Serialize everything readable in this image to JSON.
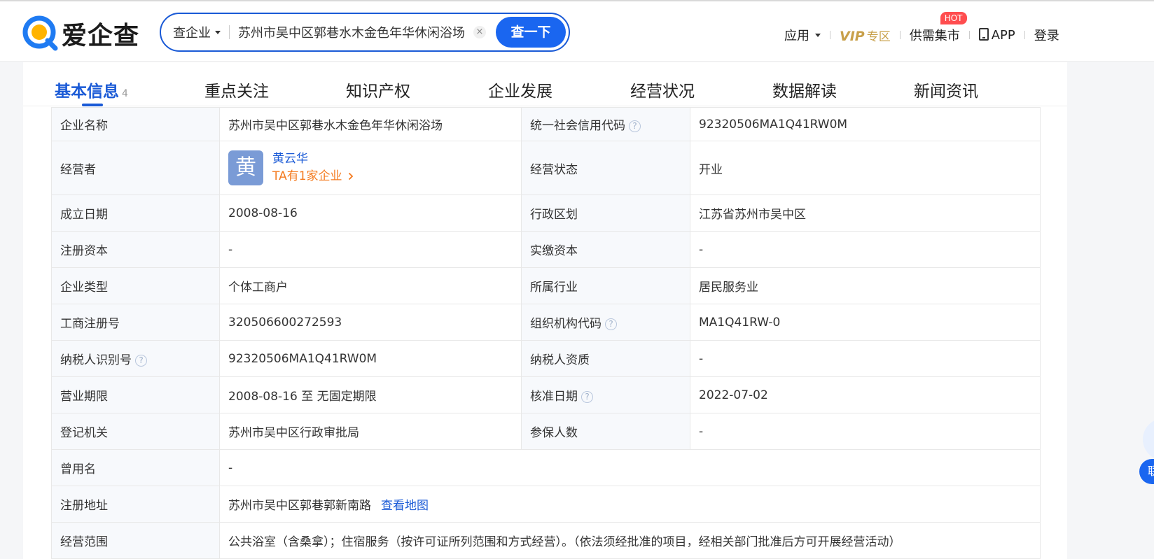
{
  "header": {
    "logo_text": "爱企查",
    "search": {
      "type_label": "查企业",
      "value": "苏州市吴中区郭巷水木金色年华休闲浴场",
      "clear_symbol": "×",
      "button_label": "查一下"
    },
    "nav": {
      "apps_label": "应用",
      "vip_label": "VIP",
      "vip_zone_label": "专区",
      "supply_label": "供需集市",
      "hot_badge": "HOT",
      "app_label": "APP",
      "login_label": "登录"
    }
  },
  "tabs": [
    {
      "label": "基本信息",
      "count": "4"
    },
    {
      "label": "重点关注"
    },
    {
      "label": "知识产权"
    },
    {
      "label": "企业发展"
    },
    {
      "label": "经营状况"
    },
    {
      "label": "数据解读"
    },
    {
      "label": "新闻资讯"
    }
  ],
  "info": {
    "company_name_label": "企业名称",
    "company_name": "苏州市吴中区郭巷水木金色年华休闲浴场",
    "credit_code_label": "统一社会信用代码",
    "credit_code": "92320506MA1Q41RW0M",
    "operator_label": "经营者",
    "operator_avatar": "黄",
    "operator_name": "黄云华",
    "operator_link": "TA有1家企业",
    "status_label": "经营状态",
    "status": "开业",
    "founded_label": "成立日期",
    "founded": "2008-08-16",
    "region_label": "行政区划",
    "region": "江苏省苏州市吴中区",
    "reg_capital_label": "注册资本",
    "reg_capital": "-",
    "paid_capital_label": "实缴资本",
    "paid_capital": "-",
    "type_label": "企业类型",
    "type": "个体工商户",
    "industry_label": "所属行业",
    "industry": "居民服务业",
    "reg_no_label": "工商注册号",
    "reg_no": "320506600272593",
    "org_code_label": "组织机构代码",
    "org_code": "MA1Q41RW-0",
    "taxpayer_id_label": "纳税人识别号",
    "taxpayer_id": "92320506MA1Q41RW0M",
    "taxpayer_qual_label": "纳税人资质",
    "taxpayer_qual": "-",
    "term_label": "营业期限",
    "term": "2008-08-16 至 无固定期限",
    "approval_date_label": "核准日期",
    "approval_date": "2022-07-02",
    "authority_label": "登记机关",
    "authority": "苏州市吴中区行政审批局",
    "insured_label": "参保人数",
    "insured": "-",
    "former_name_label": "曾用名",
    "former_name": "-",
    "address_label": "注册地址",
    "address": "苏州市吴中区郭巷郭新南路",
    "map_link": "查看地图",
    "scope_label": "经营范围",
    "scope": "公共浴室（含桑拿）；住宿服务（按许可证所列范围和方式经营）。（依法须经批准的项目，经相关部门批准后方可开展经营活动）",
    "help_symbol": "?"
  },
  "float_widget": {
    "badge_text": "联"
  },
  "colors": {
    "brand_blue": "#1a5ad6",
    "button_blue": "#1a66f0",
    "vip_gold": "#c8a04a",
    "link_orange": "#f47b20",
    "hot_red": "#ff4d4f"
  }
}
